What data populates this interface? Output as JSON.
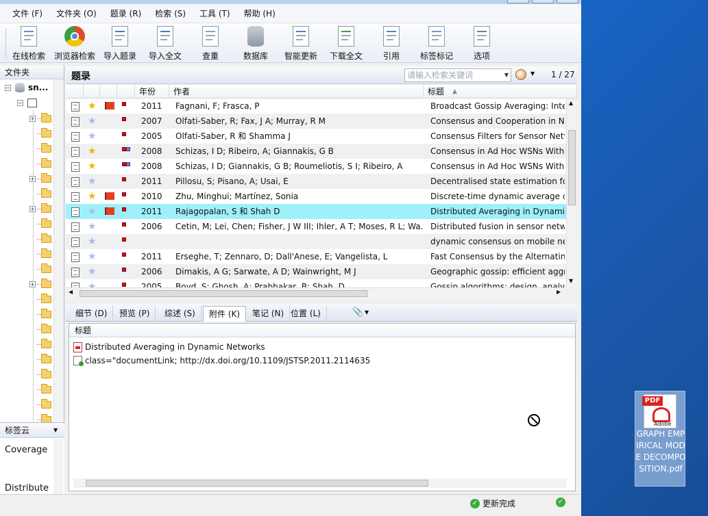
{
  "menu": [
    "文件 (F)",
    "文件夹 (O)",
    "题录 (R)",
    "检索 (S)",
    "工具 (T)",
    "帮助 (H)"
  ],
  "toolbar": [
    {
      "label": "在线检索",
      "icon": "online-search-icon"
    },
    {
      "label": "浏览器检索",
      "icon": "browser-search-icon"
    },
    {
      "label": "导入题录",
      "icon": "import-reference-icon"
    },
    {
      "label": "导入全文",
      "icon": "import-fulltext-icon"
    },
    {
      "label": "查重",
      "icon": "find-duplicates-icon"
    },
    {
      "label": "数据库",
      "icon": "database-icon"
    },
    {
      "label": "智能更新",
      "icon": "smart-update-icon"
    },
    {
      "label": "下载全文",
      "icon": "download-fulltext-icon"
    },
    {
      "label": "引用",
      "icon": "cite-icon"
    },
    {
      "label": "标签标记",
      "icon": "tag-icon"
    },
    {
      "label": "选项",
      "icon": "options-icon"
    }
  ],
  "left": {
    "header": "文件夹",
    "root_label": "sn..."
  },
  "tagcloud": {
    "header": "标签云",
    "tags": [
      "Coverage",
      "Distribute"
    ]
  },
  "list": {
    "title": "题录",
    "search_placeholder": "请输入检索关键词",
    "page": "1 / 27",
    "columns": {
      "year": "年份",
      "author": "作者",
      "title": "标题"
    },
    "rows": [
      {
        "year": "2011",
        "author": "Fagnani, F; Frasca, P",
        "title": "Broadcast Gossip Averaging: Inte",
        "star": true,
        "flag": true,
        "colors": [
          "red"
        ],
        "file": true
      },
      {
        "year": "2007",
        "author": "Olfati-Saber, R; Fax, J A; Murray, R M",
        "title": "Consensus and Cooperation in Ne",
        "star": false,
        "flag": false,
        "colors": [
          "red"
        ],
        "file": true
      },
      {
        "year": "2005",
        "author": "Olfati-Saber, R 和 Shamma J",
        "title": "Consensus Filters for Sensor Netw",
        "star": false,
        "flag": false,
        "colors": [
          "red"
        ],
        "file": false
      },
      {
        "year": "2008",
        "author": "Schizas, I D; Ribeiro, A; Giannakis, G B",
        "title": "Consensus in Ad Hoc WSNs With",
        "star": true,
        "flag": false,
        "colors": [
          "red",
          "blue"
        ],
        "file": true
      },
      {
        "year": "2008",
        "author": "Schizas, I D; Giannakis, G B; Roumeliotis, S I; Ribeiro, A",
        "title": "Consensus in Ad Hoc WSNs With",
        "star": true,
        "flag": false,
        "colors": [
          "red",
          "blue"
        ],
        "file": true
      },
      {
        "year": "2011",
        "author": "Pillosu, S; Pisano, A; Usai, E",
        "title": "Decentralised state estimation for",
        "star": false,
        "flag": false,
        "colors": [
          "red"
        ],
        "file": true
      },
      {
        "year": "2010",
        "author": "Zhu, Minghui; Martínez, Sonia",
        "title": "Discrete-time dynamic average cc",
        "star": true,
        "flag": true,
        "colors": [
          "red"
        ],
        "file": true
      },
      {
        "year": "2011",
        "author": "Rajagopalan, S 和 Shah D",
        "title": "Distributed Averaging in Dynamic",
        "star": false,
        "flag": true,
        "colors": [
          "red"
        ],
        "file": true,
        "selected": true
      },
      {
        "year": "2006",
        "author": "Cetin, M; Lei, Chen; Fisher, J W III; Ihler, A T; Moses, R L; Wa...",
        "title": "Distributed fusion in sensor netwo",
        "star": false,
        "flag": false,
        "colors": [
          "red"
        ],
        "file": true
      },
      {
        "year": "",
        "author": "",
        "title": "dynamic consensus on mobile net",
        "star": false,
        "flag": false,
        "colors": [
          "red"
        ],
        "file": true
      },
      {
        "year": "2011",
        "author": "Erseghe, T; Zennaro, D; Dall'Anese, E; Vangelista, L",
        "title": "Fast Consensus by the Alternating",
        "star": false,
        "flag": false,
        "colors": [
          "red"
        ],
        "file": true
      },
      {
        "year": "2006",
        "author": "Dimakis, A G; Sarwate, A D; Wainwright, M J",
        "title": "Geographic gossip: efficient aggr",
        "star": false,
        "flag": false,
        "colors": [
          "red"
        ],
        "file": true
      },
      {
        "year": "2005",
        "author": "Boyd, S; Ghosh, A; Prabhakar, B; Shah, D",
        "title": "Gossip algorithms: design, analys",
        "star": false,
        "flag": false,
        "colors": [
          "red"
        ],
        "file": true
      }
    ]
  },
  "tabs": [
    "细节 (D)",
    "预览 (P)",
    "综述 (S)",
    "附件 (K)",
    "笔记 (N)",
    "位置 (L)"
  ],
  "attachments": {
    "header": "标题",
    "items": [
      {
        "text": "Distributed Averaging in Dynamic Networks",
        "icon": "pdf-icon"
      },
      {
        "text": "class=\"documentLink; http://dx.doi.org/10.1109/JSTSP.2011.2114635",
        "icon": "link-icon"
      }
    ]
  },
  "status": {
    "text": "更新完成"
  },
  "desktop_icon": {
    "badge": "PDF",
    "brand": "Adobe",
    "label": "GRAPH EMPIRICAL MODE DECOMPOSITION.pdf"
  }
}
